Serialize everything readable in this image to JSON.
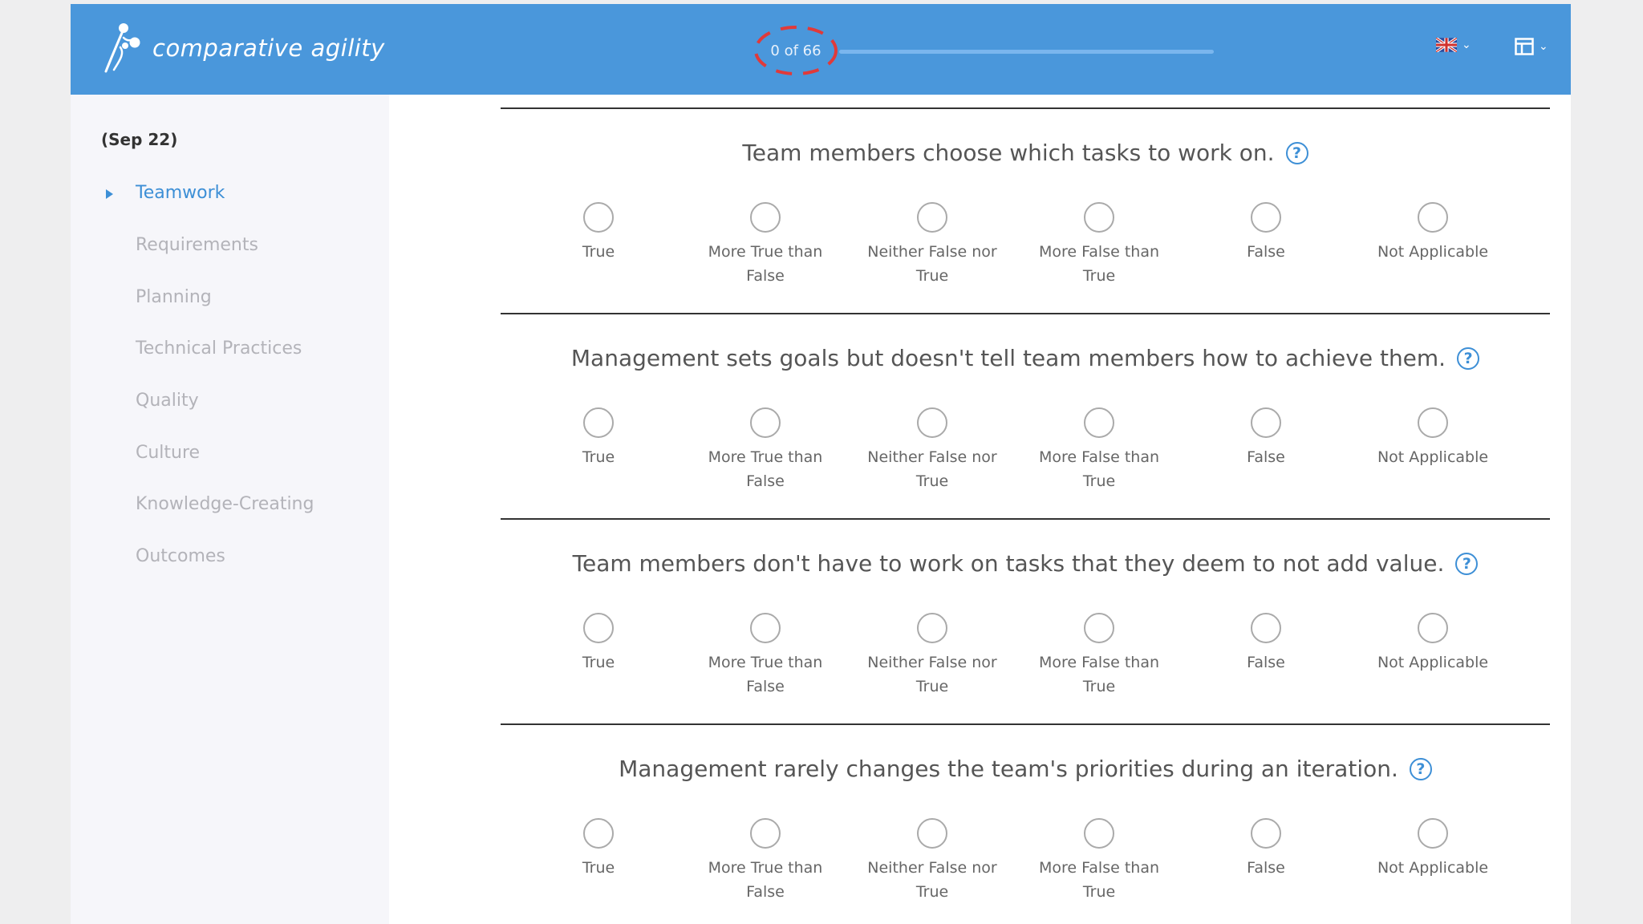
{
  "header": {
    "brand": "comparative agility",
    "progress": {
      "label": "0 of 66",
      "answered": 0,
      "total": 66
    },
    "language_icon": "uk-flag-icon",
    "layout_icon": "layout-icon"
  },
  "sidebar": {
    "title": "(Sep 22)",
    "items": [
      {
        "label": "Teamwork",
        "active": true
      },
      {
        "label": "Requirements",
        "active": false
      },
      {
        "label": "Planning",
        "active": false
      },
      {
        "label": "Technical Practices",
        "active": false
      },
      {
        "label": "Quality",
        "active": false
      },
      {
        "label": "Culture",
        "active": false
      },
      {
        "label": "Knowledge-Creating",
        "active": false
      },
      {
        "label": "Outcomes",
        "active": false
      }
    ]
  },
  "answer_options": [
    "True",
    "More True than False",
    "Neither False nor True",
    "More False than True",
    "False",
    "Not Applicable"
  ],
  "questions": [
    {
      "text": "Team members choose which tasks to work on.",
      "help": "?"
    },
    {
      "text": "Management sets goals but doesn't tell team members how to achieve them.",
      "help": "?"
    },
    {
      "text": "Team members don't have to work on tasks that they deem to not add value.",
      "help": "?"
    },
    {
      "text": "Management rarely changes the team's priorities during an iteration.",
      "help": "?"
    }
  ],
  "colors": {
    "header_bg": "#4a97db",
    "accent": "#3d8fd6",
    "highlight_ring": "#e03a3a"
  }
}
